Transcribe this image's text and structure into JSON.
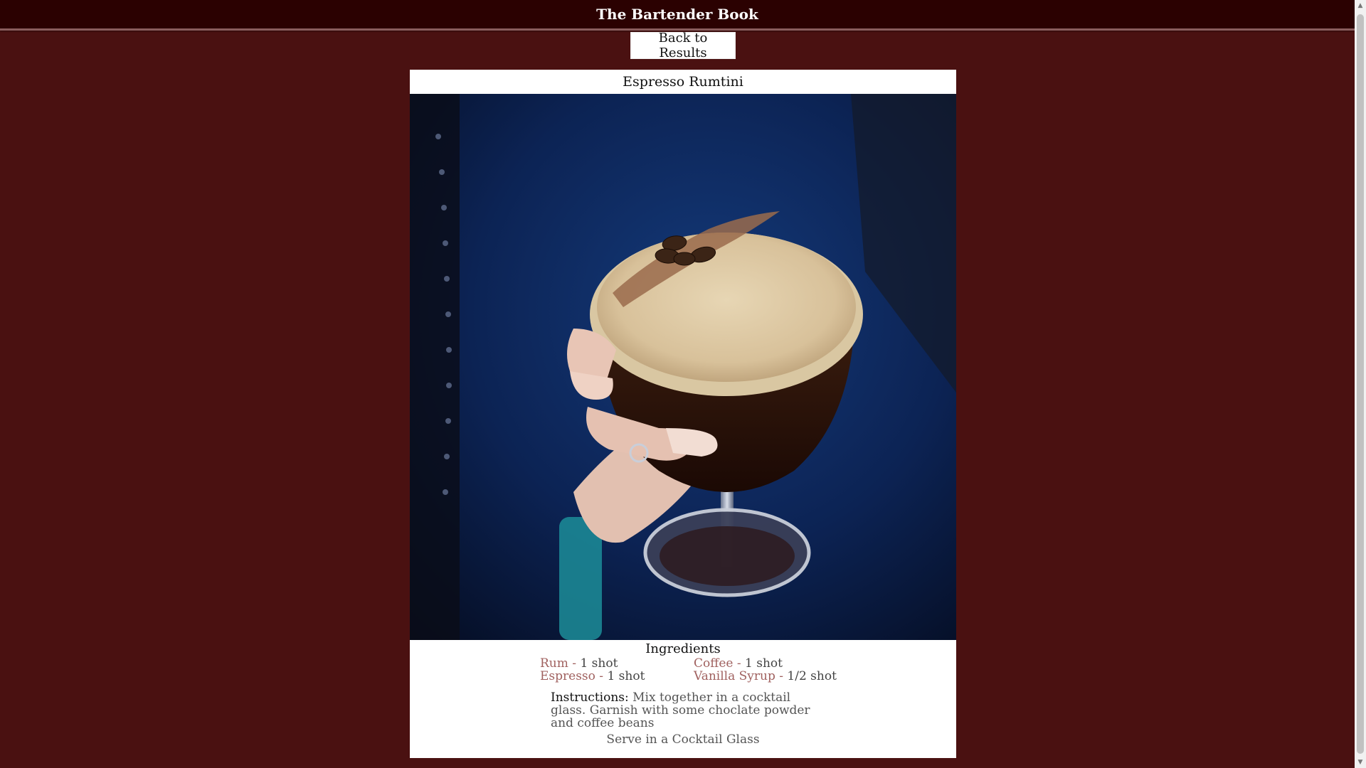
{
  "header": {
    "brand": "The Bartender Book"
  },
  "nav": {
    "back_label": "Back to Results"
  },
  "drink": {
    "name": "Espresso Rumtini",
    "image_alt": "Espresso Rumtini cocktail",
    "ingredients_title": "Ingredients",
    "ingredients": [
      {
        "name": "Rum",
        "amount": "1 shot"
      },
      {
        "name": "Coffee",
        "amount": "1 shot"
      },
      {
        "name": "Espresso",
        "amount": "1 shot"
      },
      {
        "name": "Vanilla Syrup",
        "amount": "1/2 shot"
      }
    ],
    "instructions_label": "Instructions:",
    "instructions": "Mix together in a cocktail glass. Garnish with some choclate powder and coffee beans",
    "serve": "Serve in a Cocktail Glass"
  },
  "colors": {
    "page_bg": "#4a1111",
    "header_bg": "#2b0101",
    "ingredient_name": "#a0615f"
  }
}
